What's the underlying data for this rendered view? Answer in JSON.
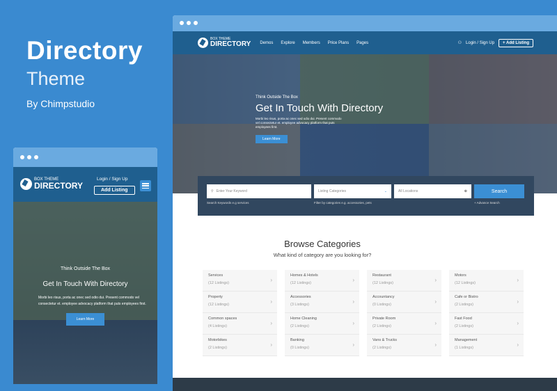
{
  "promo": {
    "title": "Directory",
    "subtitle": "Theme",
    "author": "By Chimpstudio"
  },
  "logo": {
    "small": "BOX THEME",
    "big": "DIRECTORY"
  },
  "nav": {
    "items": [
      "Demos",
      "Explore",
      "Members",
      "Price Plans",
      "Pages"
    ],
    "login": "Login / Sign Up",
    "add_listing": "Add Listing",
    "mobile_login": "Login  /  Sign Up"
  },
  "hero": {
    "kicker": "Think Outside The Box",
    "title": "Get In Touch With Directory",
    "text": "Morbi leo risus, porta ac onec sed odio dui. Present commodo vel consectetur et. employee advocacy platform that puts employees first.",
    "button": "Learn More"
  },
  "search": {
    "keyword_placeholder": "Enter Your Keyword",
    "category": "Listing Categories",
    "location": "All Locations",
    "button": "Search",
    "hint_keyword": "Search Keywords e.g services",
    "hint_category": "Filter by categories e.g. accessories, pets",
    "advance": "+ Advance Search"
  },
  "browse": {
    "title": "Browse Categories",
    "subtitle": "What kind of category are you looking for?",
    "columns": [
      [
        {
          "name": "Services",
          "count": "(12 Listings)"
        },
        {
          "name": "Property",
          "count": "(12 Listings)"
        },
        {
          "name": "Common spaces",
          "count": "(4 Listings)"
        },
        {
          "name": "Motorbikes",
          "count": "(2 Listings)"
        }
      ],
      [
        {
          "name": "Homes & Hotels",
          "count": "(12 Listings)"
        },
        {
          "name": "Accessories",
          "count": "(3 Listings)"
        },
        {
          "name": "Home Cleaning",
          "count": "(2 Listings)"
        },
        {
          "name": "Banking",
          "count": "(0 Listings)"
        }
      ],
      [
        {
          "name": "Restaurant",
          "count": "(12 Listings)"
        },
        {
          "name": "Accountancy",
          "count": "(0 Listings)"
        },
        {
          "name": "Private Room",
          "count": "(2 Listings)"
        },
        {
          "name": "Vans & Trucks",
          "count": "(2 Listings)"
        }
      ],
      [
        {
          "name": "Motors",
          "count": "(12 Listings)"
        },
        {
          "name": "Cafe or Bistro",
          "count": "(2 Listings)"
        },
        {
          "name": "Fast Food",
          "count": "(2 Listings)"
        },
        {
          "name": "Management",
          "count": "(1 Listings)"
        }
      ]
    ]
  },
  "colors": {
    "background": "#3a8ad0",
    "nav": "#1f5f8f",
    "accent": "#3b8fd4"
  }
}
